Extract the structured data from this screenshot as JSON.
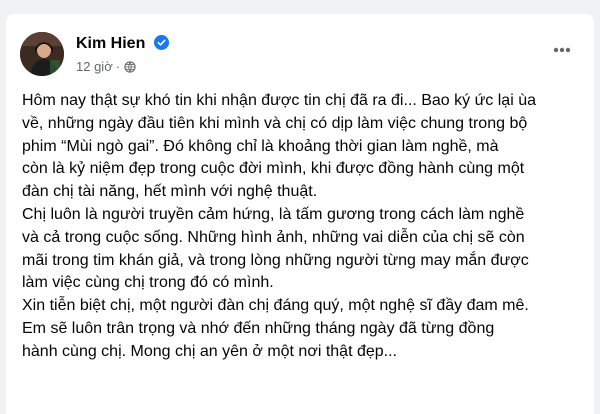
{
  "post": {
    "author": "Kim Hien",
    "verified": true,
    "timestamp": "12 giờ",
    "separator": "·",
    "audience_icon": "globe-icon",
    "more_icon": "more-options-icon",
    "lines": [
      "Hôm nay thật sự khó tin khi nhận được tin chị đã ra đi... Bao ký ức lại ùa",
      "về, những ngày đầu tiên khi mình và chị có dịp làm việc chung trong bộ",
      "phim “Mùi ngò gai”. Đó không chỉ là khoảng thời gian làm nghề, mà",
      "còn là kỷ niệm đẹp trong cuộc đời mình, khi được đồng hành cùng một",
      "đàn chị tài năng, hết mình với nghệ thuật.",
      "Chị luôn là người truyền cảm hứng, là tấm gương trong cách làm nghề",
      "và cả trong cuộc sống. Những hình ảnh, những vai diễn của chị sẽ còn",
      "mãi trong tim khán giả, và trong lòng những người từng may mắn được",
      "làm việc cùng chị trong đó có mình.",
      "Xin tiễn biệt chị, một người đàn chị đáng quý, một nghệ sĩ đầy đam mê.",
      "Em sẽ luôn trân trọng và nhớ đến những tháng ngày đã từng đồng",
      "hành cùng chị. Mong chị an yên ở một nơi thật đẹp..."
    ]
  },
  "colors": {
    "background": "#f0f2f5",
    "card": "#ffffff",
    "text": "#050505",
    "secondary_text": "#65676b",
    "verified_badge": "#1877f2"
  }
}
